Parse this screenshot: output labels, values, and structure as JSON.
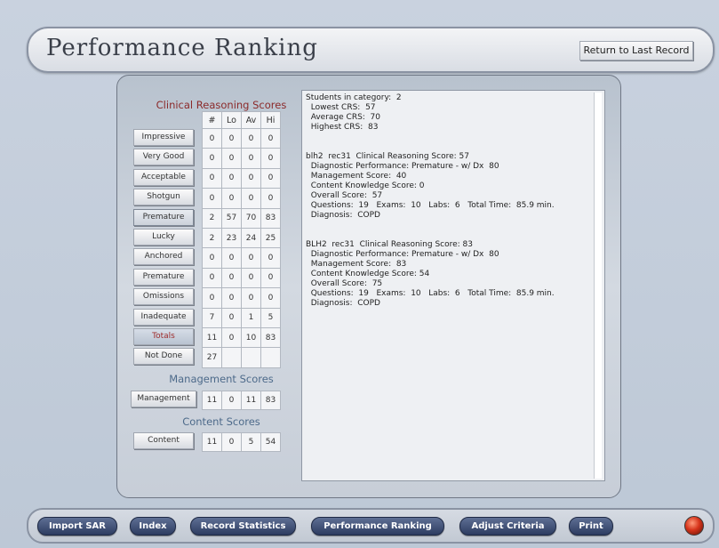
{
  "header": {
    "title": "Performance Ranking",
    "return_label": "Return to Last Record"
  },
  "sections": {
    "clinical_title": "Clinical Reasoning Scores",
    "management_title": "Management Scores",
    "content_title": "Content Scores"
  },
  "table_headers": [
    "#",
    "Lo",
    "Av",
    "Hi"
  ],
  "clinical_rows": [
    {
      "label": "Impressive",
      "values": [
        "0",
        "0",
        "0",
        "0"
      ]
    },
    {
      "label": "Very Good",
      "values": [
        "0",
        "0",
        "0",
        "0"
      ]
    },
    {
      "label": "Acceptable",
      "values": [
        "0",
        "0",
        "0",
        "0"
      ]
    },
    {
      "label": "Shotgun",
      "values": [
        "0",
        "0",
        "0",
        "0"
      ]
    },
    {
      "label": "Premature",
      "values": [
        "2",
        "57",
        "70",
        "83"
      ]
    },
    {
      "label": "Lucky",
      "values": [
        "2",
        "23",
        "24",
        "25"
      ]
    },
    {
      "label": "Anchored",
      "values": [
        "0",
        "0",
        "0",
        "0"
      ]
    },
    {
      "label": "Premature",
      "values": [
        "0",
        "0",
        "0",
        "0"
      ]
    },
    {
      "label": "Omissions",
      "values": [
        "0",
        "0",
        "0",
        "0"
      ]
    },
    {
      "label": "Inadequate",
      "values": [
        "7",
        "0",
        "1",
        "5"
      ]
    },
    {
      "label": "Totals",
      "values": [
        "11",
        "0",
        "10",
        "83"
      ]
    },
    {
      "label": "Not Done",
      "values": [
        "27",
        "",
        "",
        ""
      ]
    }
  ],
  "management_row": {
    "label": "Management",
    "values": [
      "11",
      "0",
      "11",
      "83"
    ]
  },
  "content_row": {
    "label": "Content",
    "values": [
      "11",
      "0",
      "5",
      "54"
    ]
  },
  "results_text": "Students in category:  2\n  Lowest CRS:  57\n  Average CRS:  70\n  Highest CRS:  83\n\n\nblh2  rec31  Clinical Reasoning Score: 57\n  Diagnostic Performance: Premature - w/ Dx  80\n  Management Score:  40\n  Content Knowledge Score: 0\n  Overall Score:  57\n  Questions:  19   Exams:  10   Labs:  6   Total Time:  85.9 min.\n  Diagnosis:  COPD\n\n\nBLH2  rec31  Clinical Reasoning Score: 83\n  Diagnostic Performance: Premature - w/ Dx  80\n  Management Score:  83\n  Content Knowledge Score: 54\n  Overall Score:  75\n  Questions:  19   Exams:  10   Labs:  6   Total Time:  85.9 min.\n  Diagnosis:  COPD",
  "nav": {
    "import_sar": "Import SAR",
    "index": "Index",
    "record_statistics": "Record Statistics",
    "performance_ranking": "Performance Ranking",
    "adjust_criteria": "Adjust Criteria",
    "print": "Print"
  },
  "colors": {
    "section_title": "#8b2a2a",
    "section_title_alt": "#4d6a8a",
    "nav_button": "#2d3c61",
    "power_button": "#d6331a"
  },
  "icons": {
    "power": "power-icon"
  }
}
